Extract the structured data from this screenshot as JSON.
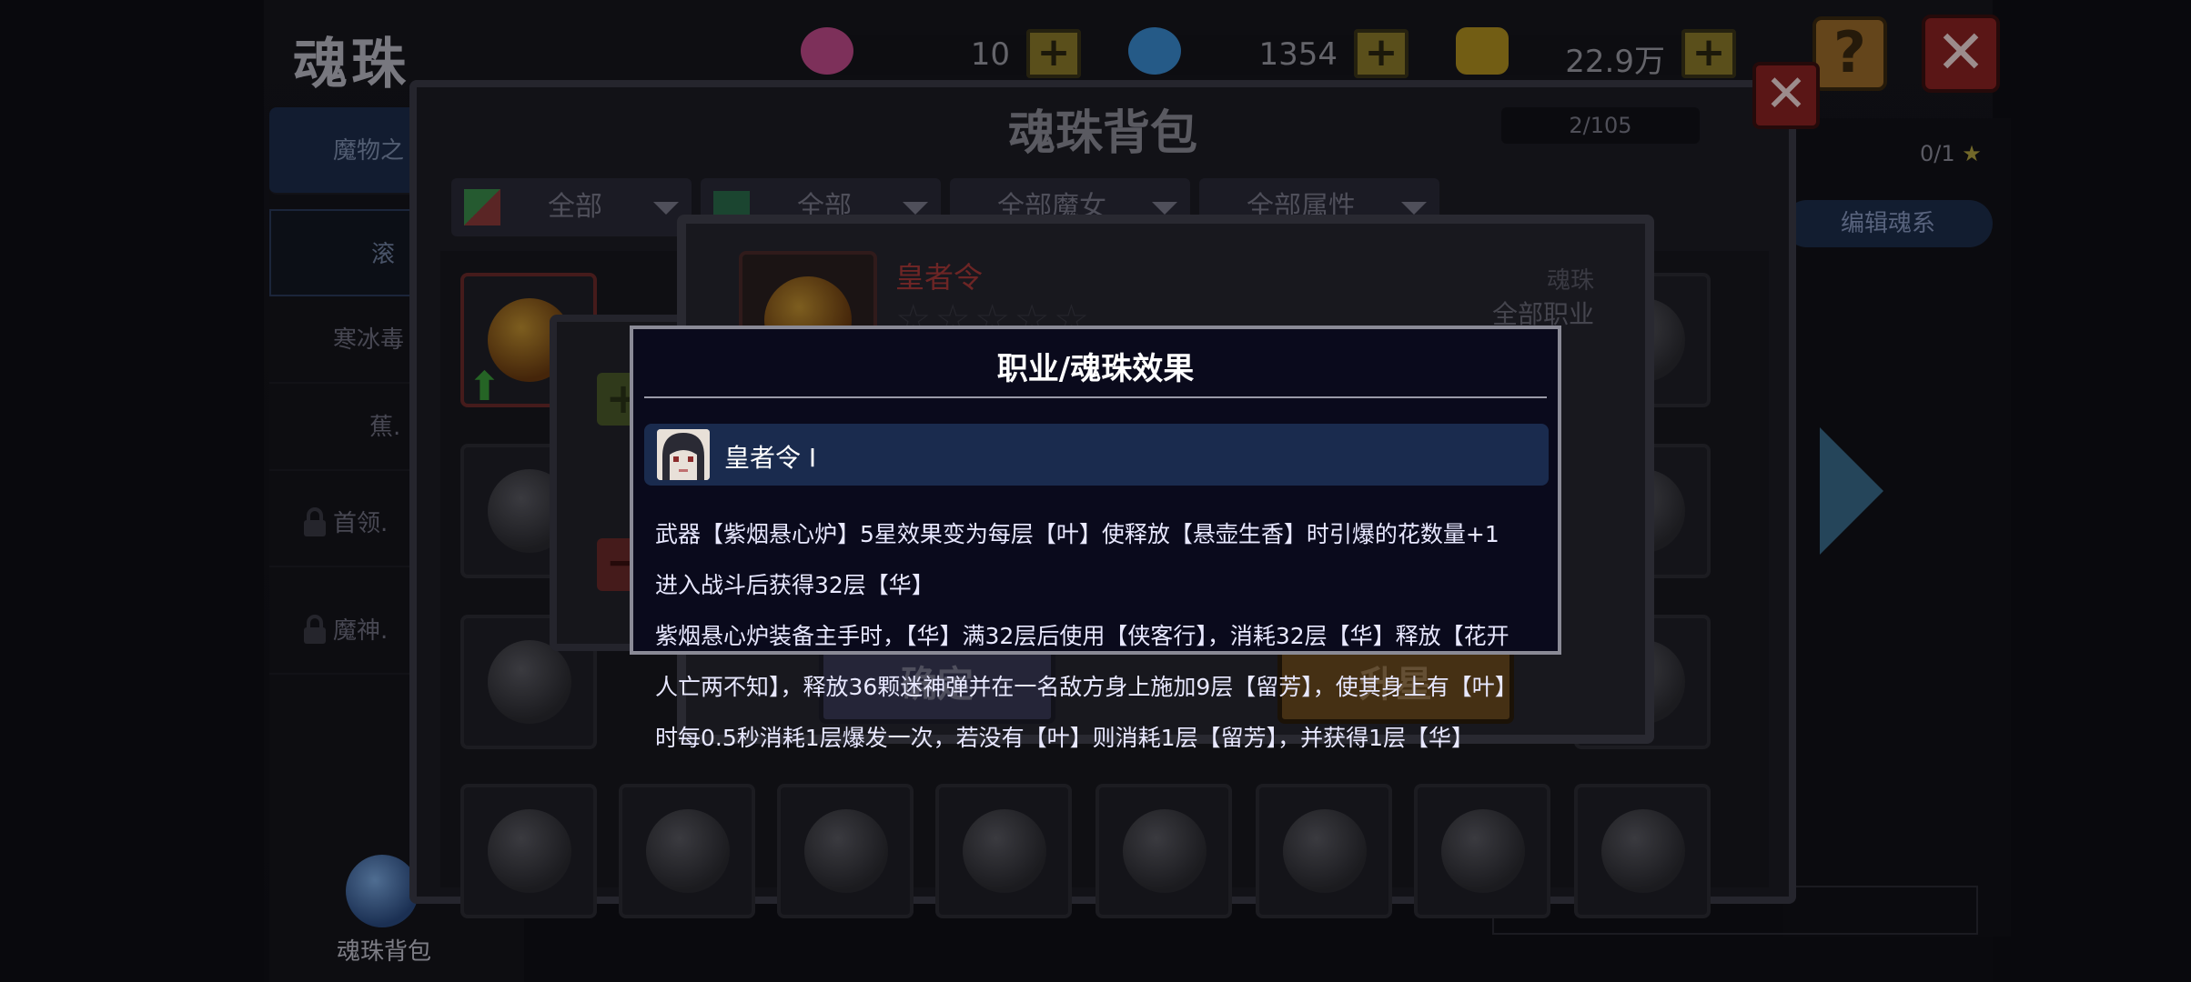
{
  "page": {
    "title": "魂珠"
  },
  "currency": [
    {
      "name": "purple-gem",
      "value": "10",
      "color": "#d04a90"
    },
    {
      "name": "blue-gem",
      "value": "1354",
      "color": "#3a8ad0"
    },
    {
      "name": "gold",
      "value": "22.9万",
      "color": "#c0a020"
    }
  ],
  "sidebar": {
    "items": [
      {
        "label": "魔物之"
      },
      {
        "label": "滚"
      },
      {
        "label": "寒冰毒"
      },
      {
        "label": "蕉."
      },
      {
        "label": "首领.",
        "locked": true
      },
      {
        "label": "魔神.",
        "locked": true
      }
    ],
    "bag_label": "魂珠背包"
  },
  "right_panel": {
    "counter": "0/1",
    "edit_button": "编辑魂系"
  },
  "bag": {
    "title": "魂珠背包",
    "count": "2/105",
    "filters": [
      "全部",
      "全部",
      "全部魔女",
      "全部属性"
    ]
  },
  "detail": {
    "name": "皇者令",
    "type": "魂珠",
    "class": "全部职业",
    "confirm_label": "确定",
    "upgrade_label": "升星"
  },
  "effect_dialog": {
    "title": "职业/魂珠效果",
    "row_name": "皇者令 I",
    "lines": [
      "武器【紫烟悬心炉】5星效果变为每层【叶】使释放【悬壶生香】时引爆的花数量+1",
      "进入战斗后获得32层【华】",
      "紫烟悬心炉装备主手时，【华】满32层后使用【侠客行】，消耗32层【华】释放【花开",
      "人亡两不知】，释放36颗迷神弹并在一名敌方身上施加9层【留芳】，使其身上有【叶】",
      "时每0.5秒消耗1层爆发一次，若没有【叶】则消耗1层【留芳】，并获得1层【华】"
    ]
  }
}
